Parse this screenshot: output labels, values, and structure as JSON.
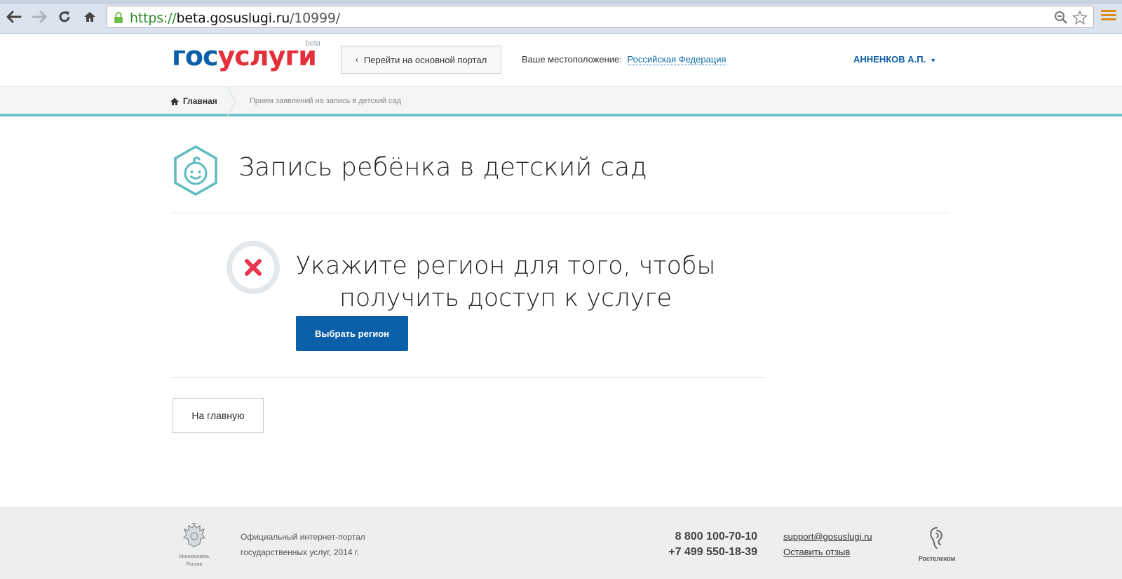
{
  "browser": {
    "url_scheme": "https://",
    "url_host": "beta.gosuslugi.ru",
    "url_path": "/10999/"
  },
  "header": {
    "logo_part1": "гос",
    "logo_part2": "услуги",
    "logo_badge": "beta",
    "portal_button": "Перейти на основной портал",
    "location_label": "Ваше местоположение:",
    "location_value": "Российская Федерация",
    "user_name": "АННЕНКОВ А.П."
  },
  "breadcrumb": {
    "home": "Главная",
    "current": "Прием заявлений на запись в детский сад"
  },
  "main": {
    "title": "Запись ребёнка в детский сад",
    "message_line1": "Укажите регион для того, чтобы",
    "message_line2": "получить доступ к услуге",
    "region_button": "Выбрать регион",
    "home_button": "На главную"
  },
  "footer": {
    "emblem_label1": "Минкомсвязь",
    "emblem_label2": "России",
    "portal_line1": "Официальный интернет-портал",
    "portal_line2": "государственных услуг, 2014 г.",
    "phone1": "8 800 100-70-10",
    "phone2": "+7 499 550-18-39",
    "email": "support@gosuslugi.ru",
    "feedback": "Оставить отзыв",
    "partner": "Ростелеком"
  },
  "colors": {
    "brand_blue": "#0b5ea8",
    "brand_red": "#e3303b",
    "accent_teal": "#6ec5c8",
    "error_red": "#e8364f"
  }
}
